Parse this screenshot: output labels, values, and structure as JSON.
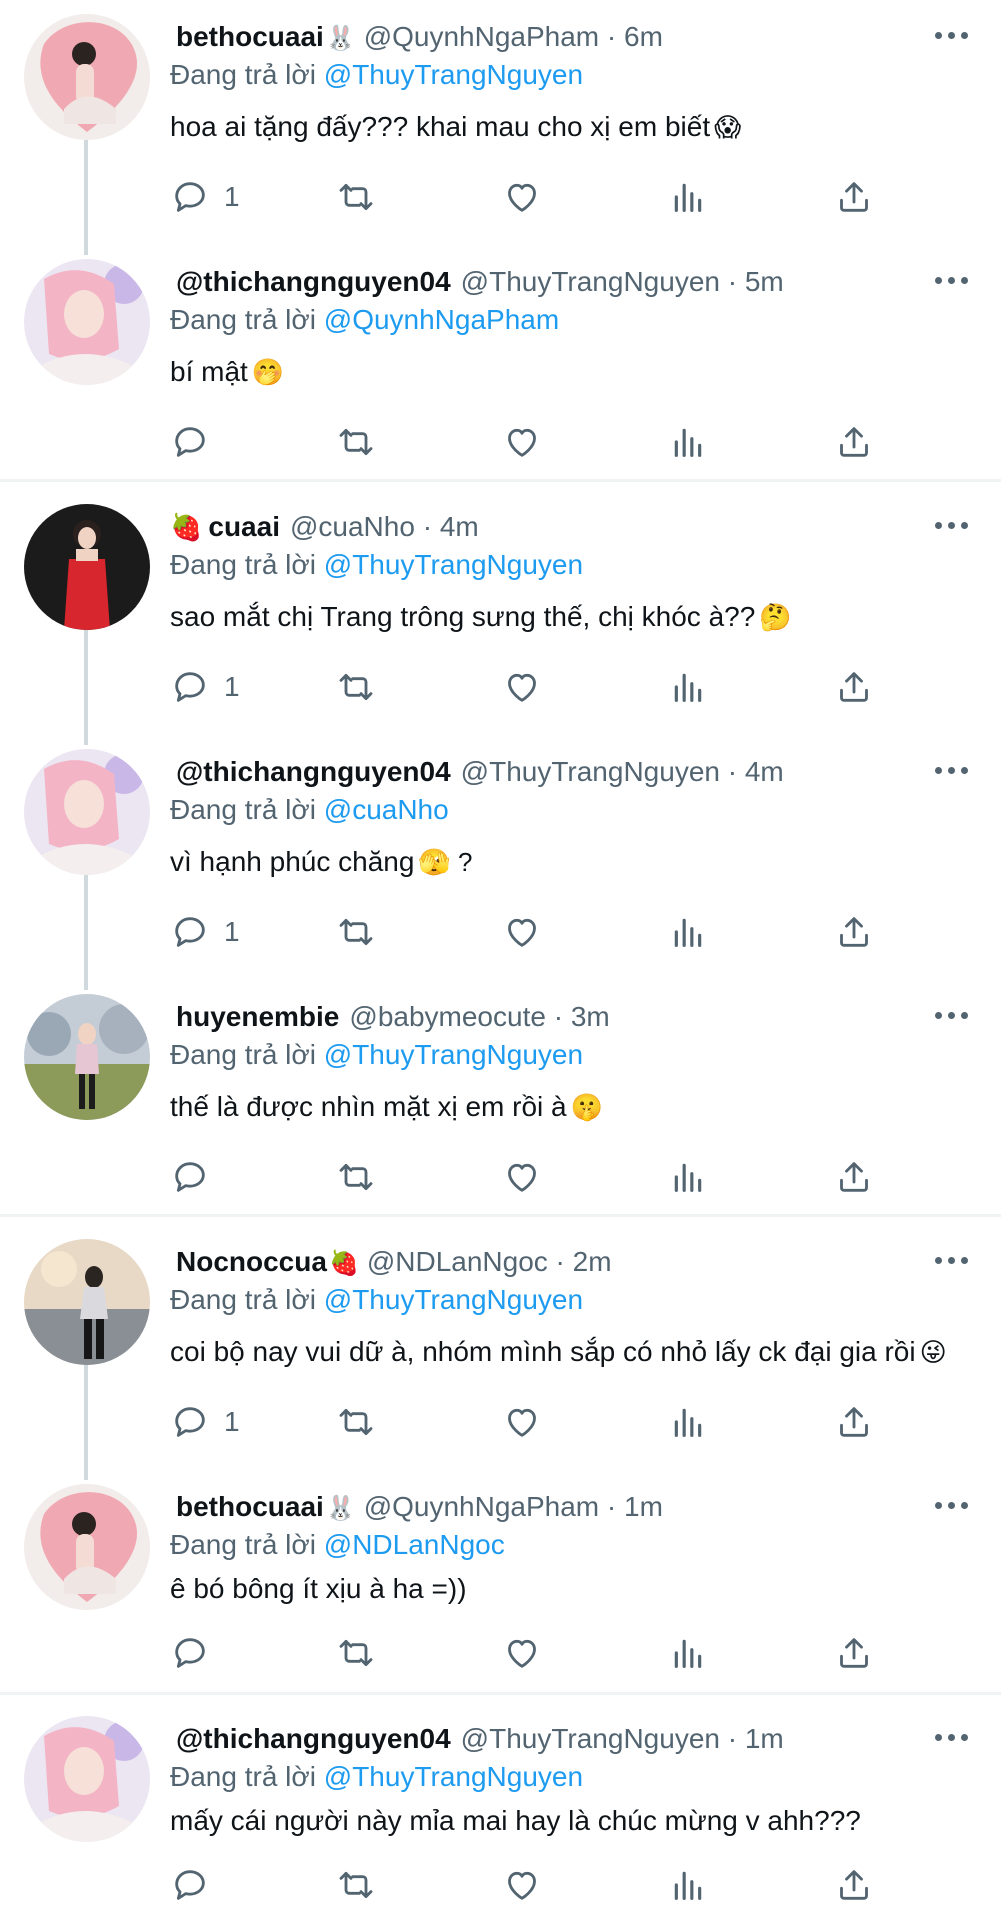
{
  "reply_prefix": "Đang trả lời",
  "tweets": [
    {
      "name": "bethocuaai",
      "name_emoji": "🐰",
      "lead_emoji": "",
      "handle": "@QuynhNgaPham",
      "time": "6m",
      "reply_to": "@ThuyTrangNguyen",
      "text": "hoa ai tặng đấy??? khai mau cho xị em biết",
      "text_emoji": "😱",
      "reply_count": "1"
    },
    {
      "name": "@thichangnguyen04",
      "name_emoji": "",
      "lead_emoji": "",
      "handle": "@ThuyTrangNguyen",
      "time": "5m",
      "reply_to": "@QuynhNgaPham",
      "text": "bí mật",
      "text_emoji": "🤭",
      "reply_count": ""
    },
    {
      "name": "cuaai",
      "name_emoji": "",
      "lead_emoji": "🍓",
      "handle": "@cuaNho",
      "time": "4m",
      "reply_to": "@ThuyTrangNguyen",
      "text": "sao mắt chị Trang trông sưng thế, chị khóc à??",
      "text_emoji": "🤔",
      "reply_count": "1"
    },
    {
      "name": "@thichangnguyen04",
      "name_emoji": "",
      "lead_emoji": "",
      "handle": "@ThuyTrangNguyen",
      "time": "4m",
      "reply_to": "@cuaNho",
      "text": "vì hạnh phúc chăng",
      "text_emoji": "🫣 ?",
      "reply_count": "1"
    },
    {
      "name": "huyenembie",
      "name_emoji": "",
      "lead_emoji": "",
      "handle": "@babymeocute",
      "time": "3m",
      "reply_to": "@ThuyTrangNguyen",
      "text": "thế là được nhìn mặt xị em rồi à",
      "text_emoji": "🤫",
      "reply_count": ""
    },
    {
      "name": "Nocnoccua",
      "name_emoji": "🍓",
      "lead_emoji": "",
      "handle": "@NDLanNgoc",
      "time": "2m",
      "reply_to": "@ThuyTrangNguyen",
      "text": "coi bộ nay vui dữ à, nhóm mình sắp có nhỏ lấy ck đại gia rồi",
      "text_emoji": "😜",
      "reply_count": "1"
    },
    {
      "name": "bethocuaai",
      "name_emoji": "🐰",
      "lead_emoji": "",
      "handle": "@QuynhNgaPham",
      "time": "1m",
      "reply_to": "@NDLanNgoc",
      "text": "ê bó bông ít xịu à ha =))",
      "text_emoji": "",
      "reply_count": ""
    },
    {
      "name": "@thichangnguyen04",
      "name_emoji": "",
      "lead_emoji": "",
      "handle": "@ThuyTrangNguyen",
      "time": "1m",
      "reply_to": "@ThuyTrangNguyen",
      "text": "mấy cái người này mỉa mai hay là chúc mừng v ahh???",
      "text_emoji": "",
      "reply_count": ""
    }
  ],
  "icons": {
    "reply": "reply-icon",
    "retweet": "retweet-icon",
    "like": "like-icon",
    "views": "views-icon",
    "share": "share-icon",
    "more": "more-icon"
  },
  "colors": {
    "mention": "#1d9bf0",
    "secondary_text": "#536471",
    "thread_line": "#cfd9de",
    "divider": "#eff3f4"
  }
}
